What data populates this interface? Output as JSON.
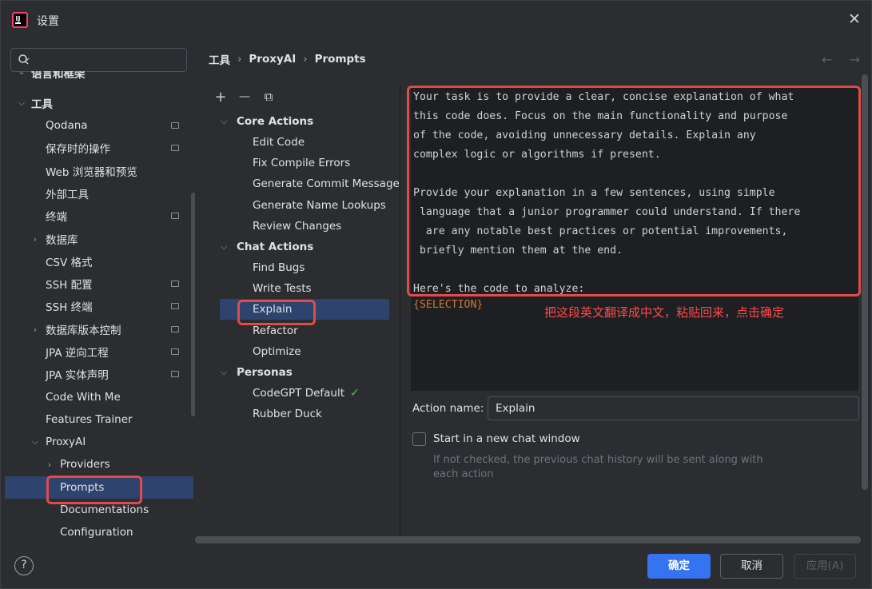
{
  "window": {
    "title": "设置"
  },
  "search": {
    "value": "",
    "placeholder": ""
  },
  "tree": {
    "partial_top": "语言和框架",
    "tools": "工具",
    "items": [
      {
        "label": "Qodana"
      },
      {
        "label": "保存时的操作"
      },
      {
        "label": "Web 浏览器和预览"
      },
      {
        "label": "外部工具"
      },
      {
        "label": "终端"
      },
      {
        "label": "数据库"
      },
      {
        "label": "CSV 格式"
      },
      {
        "label": "SSH 配置"
      },
      {
        "label": "SSH 终端"
      },
      {
        "label": "数据库版本控制"
      },
      {
        "label": "JPA 逆向工程"
      },
      {
        "label": "JPA 实体声明"
      },
      {
        "label": "Code With Me"
      },
      {
        "label": "Features Trainer"
      },
      {
        "label": "ProxyAI"
      },
      {
        "label": "Providers"
      },
      {
        "label": "Prompts"
      },
      {
        "label": "Documentations"
      },
      {
        "label": "Configuration"
      }
    ]
  },
  "breadcrumb": {
    "part1": "工具",
    "part2": "ProxyAI",
    "part3": "Prompts"
  },
  "toolbar": {
    "add": "+",
    "remove": "—",
    "copy": "⧉"
  },
  "actions": {
    "core_group": "Core Actions",
    "core": [
      "Edit Code",
      "Fix Compile Errors",
      "Generate Commit Message",
      "Generate Name Lookups",
      "Review Changes"
    ],
    "chat_group": "Chat Actions",
    "chat": [
      "Find Bugs",
      "Write Tests",
      "Explain",
      "Refactor",
      "Optimize"
    ],
    "personas_group": "Personas",
    "personas": [
      "CodeGPT Default",
      "Rubber Duck"
    ]
  },
  "editor": {
    "text": "Your task is to provide a clear, concise explanation of what \nthis code does. Focus on the main functionality and purpose \nof the code, avoiding unnecessary details. Explain any \ncomplex logic or algorithms if present.\n\nProvide your explanation in a few sentences, using simple\n language that a junior programmer could understand. If there\n  are any notable best practices or potential improvements,\n briefly mention them at the end.\n\nHere's the code to analyze:",
    "selection_var": "{SELECTION}"
  },
  "annotation": "把这段英文翻译成中文，粘贴回来，点击确定",
  "form": {
    "action_name_label": "Action name:",
    "action_name_value": "Explain",
    "checkbox_label": "Start in a new chat window",
    "hint": "If not checked, the previous chat history will be sent along with each action"
  },
  "buttons": {
    "help": "?",
    "ok": "确定",
    "cancel": "取消",
    "apply": "应用(A)"
  },
  "colors": {
    "accent": "#3574f0",
    "selection": "#2e436e",
    "highlight": "#e04b4b",
    "annotation": "#ff4a4a"
  }
}
